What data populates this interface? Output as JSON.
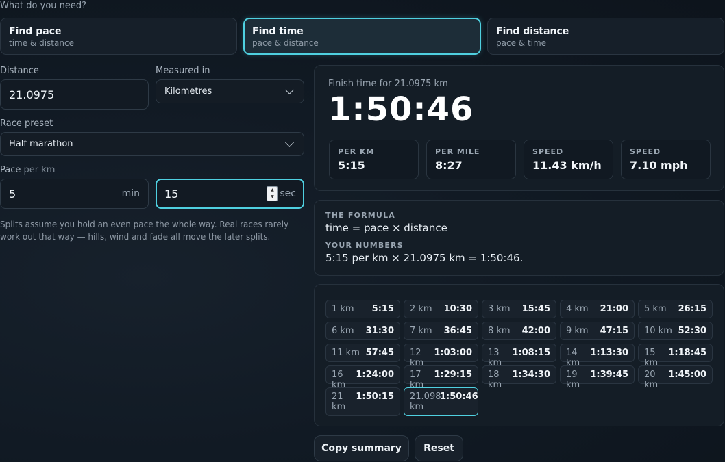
{
  "question": "What do you need?",
  "modes": [
    {
      "title": "Find pace",
      "sub": "time & distance"
    },
    {
      "title": "Find time",
      "sub": "pace & distance"
    },
    {
      "title": "Find distance",
      "sub": "pace & time"
    }
  ],
  "distance": {
    "label": "Distance",
    "value": "21.0975"
  },
  "measured": {
    "label": "Measured in",
    "value": "Kilometres"
  },
  "preset": {
    "label": "Race preset",
    "value": "Half marathon"
  },
  "pace": {
    "label": "Pace",
    "label_sub": "per km",
    "min": "5",
    "min_unit": "min",
    "sec": "15",
    "sec_unit": "sec"
  },
  "note": "Splits assume you hold an even pace the whole way. Real races rarely work out that way — hills, wind and fade all move the later splits.",
  "result": {
    "caption": "Finish time for 21.0975 km",
    "time": "1:50:46",
    "stats": [
      {
        "k": "PER KM",
        "v": "5:15"
      },
      {
        "k": "PER MILE",
        "v": "8:27"
      },
      {
        "k": "SPEED",
        "v": "11.43 km/h"
      },
      {
        "k": "SPEED",
        "v": "7.10 mph"
      }
    ]
  },
  "formula": {
    "heading": "THE FORMULA",
    "text": "time = pace × distance",
    "numbers_heading": "YOUR NUMBERS",
    "numbers_text": "5:15 per km × 21.0975 km = 1:50:46."
  },
  "splits": [
    {
      "k": "1 km",
      "t": "5:15"
    },
    {
      "k": "2 km",
      "t": "10:30"
    },
    {
      "k": "3 km",
      "t": "15:45"
    },
    {
      "k": "4 km",
      "t": "21:00"
    },
    {
      "k": "5 km",
      "t": "26:15"
    },
    {
      "k": "6 km",
      "t": "31:30"
    },
    {
      "k": "7 km",
      "t": "36:45"
    },
    {
      "k": "8 km",
      "t": "42:00"
    },
    {
      "k": "9 km",
      "t": "47:15"
    },
    {
      "k": "10 km",
      "t": "52:30"
    },
    {
      "k": "11 km",
      "t": "57:45"
    },
    {
      "k": "12 km",
      "t": "1:03:00"
    },
    {
      "k": "13 km",
      "t": "1:08:15"
    },
    {
      "k": "14 km",
      "t": "1:13:30"
    },
    {
      "k": "15 km",
      "t": "1:18:45"
    },
    {
      "k": "16 km",
      "t": "1:24:00"
    },
    {
      "k": "17 km",
      "t": "1:29:15"
    },
    {
      "k": "18 km",
      "t": "1:34:30"
    },
    {
      "k": "19 km",
      "t": "1:39:45"
    },
    {
      "k": "20 km",
      "t": "1:45:00"
    },
    {
      "k": "21 km",
      "t": "1:50:15"
    },
    {
      "k": "21.098 km",
      "t": "1:50:46"
    }
  ],
  "buttons": {
    "copy": "Copy summary",
    "reset": "Reset"
  },
  "colors": {
    "accent": "#4fd0e0",
    "background": "#111a24"
  }
}
